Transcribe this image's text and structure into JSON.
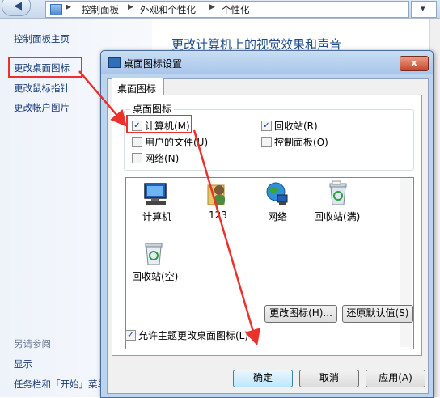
{
  "breadcrumb": {
    "part1": "控制面板",
    "part2": "外观和个性化",
    "part3": "个性化"
  },
  "sidebar": {
    "home": "控制面板主页",
    "desktop_icons": "更改桌面图标",
    "mouse_pointer": "更改鼠标指针",
    "account_picture": "更改帐户图片",
    "see_also": "另请参阅",
    "display": "显示",
    "taskbar": "任务栏和「开始」菜单"
  },
  "content": {
    "title": "更改计算机上的视觉效果和声音"
  },
  "dialog": {
    "title": "桌面图标设置",
    "close": "x",
    "tab": "桌面图标",
    "group_label": "桌面图标",
    "checkboxes": [
      {
        "label": "计算机(M)",
        "checked": true,
        "mark": "✓"
      },
      {
        "label": "回收站(R)",
        "checked": true,
        "mark": "✓"
      },
      {
        "label": "用户的文件(U)",
        "checked": false,
        "mark": ""
      },
      {
        "label": "控制面板(O)",
        "checked": false,
        "mark": ""
      },
      {
        "label": "网络(N)",
        "checked": false,
        "mark": ""
      }
    ],
    "icons": [
      {
        "label": "计算机",
        "icon": "computer-icon"
      },
      {
        "label": "123",
        "icon": "user-folder-icon"
      },
      {
        "label": "网络",
        "icon": "network-icon"
      },
      {
        "label": "回收站(满)",
        "icon": "recycle-bin-full-icon"
      },
      {
        "label": "回收站(空)",
        "icon": "recycle-bin-empty-icon"
      }
    ],
    "change_icon_btn": "更改图标(H)...",
    "restore_default_btn": "还原默认值(S)",
    "allow_themes": {
      "label": "允许主题更改桌面图标(L)",
      "checked": true,
      "mark": "✓"
    },
    "ok": "确定",
    "cancel": "取消",
    "apply": "应用(A)"
  },
  "colors": {
    "annotation_red": "#e8322b",
    "link": "#1a3c74",
    "title_blue": "#1f4e8c"
  }
}
